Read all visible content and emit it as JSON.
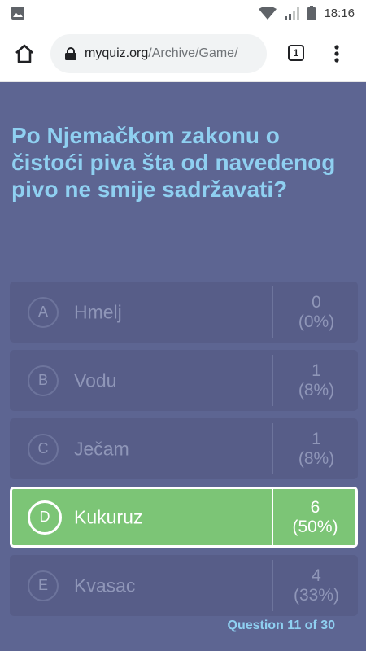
{
  "status_bar": {
    "time": "18:16",
    "icons": [
      "image-icon",
      "wifi-icon",
      "signal-icon",
      "battery-icon"
    ]
  },
  "browser": {
    "url_host": "myquiz.org",
    "url_path": "/Archive/Game/",
    "tab_count": "1",
    "icons": [
      "home-icon",
      "lock-icon",
      "more-vert-icon"
    ]
  },
  "quiz": {
    "question": "Po Njemačkom zakonu o čistoći piva šta od navedenog pivo ne smije sadržavati?",
    "answers": [
      {
        "letter": "A",
        "text": "Hmelj",
        "count": "0",
        "percent": "(0%)",
        "correct": false
      },
      {
        "letter": "B",
        "text": "Vodu",
        "count": "1",
        "percent": "(8%)",
        "correct": false
      },
      {
        "letter": "C",
        "text": "Ječam",
        "count": "1",
        "percent": "(8%)",
        "correct": false
      },
      {
        "letter": "D",
        "text": "Kukuruz",
        "count": "6",
        "percent": "(50%)",
        "correct": true
      },
      {
        "letter": "E",
        "text": "Kvasac",
        "count": "4",
        "percent": "(33%)",
        "correct": false
      }
    ],
    "counter": "Question 11 of 30"
  },
  "colors": {
    "background": "#5d6592",
    "answer_bg": "#575d88",
    "correct_bg": "#7cc576",
    "question_text": "#8fd0f1"
  }
}
